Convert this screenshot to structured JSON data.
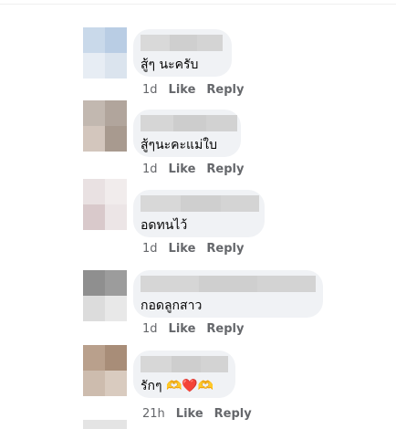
{
  "comments": [
    {
      "text": "สู้ๆ นะครับ",
      "time": "1d",
      "like": "Like",
      "reply": "Reply"
    },
    {
      "text": "สู้ๆนะคะแม่ใบ",
      "time": "1d",
      "like": "Like",
      "reply": "Reply"
    },
    {
      "text": "อดทนไว้",
      "time": "1d",
      "like": "Like",
      "reply": "Reply"
    },
    {
      "text": "กอดลูกสาว",
      "time": "1d",
      "like": "Like",
      "reply": "Reply"
    },
    {
      "text": "รักๆ",
      "emojis": "🫶❤️🫶",
      "time": "21h",
      "like": "Like",
      "reply": "Reply"
    }
  ],
  "colors": {
    "bubble": "#f0f2f5",
    "action_text": "#65676b",
    "comment_text": "#050505"
  }
}
